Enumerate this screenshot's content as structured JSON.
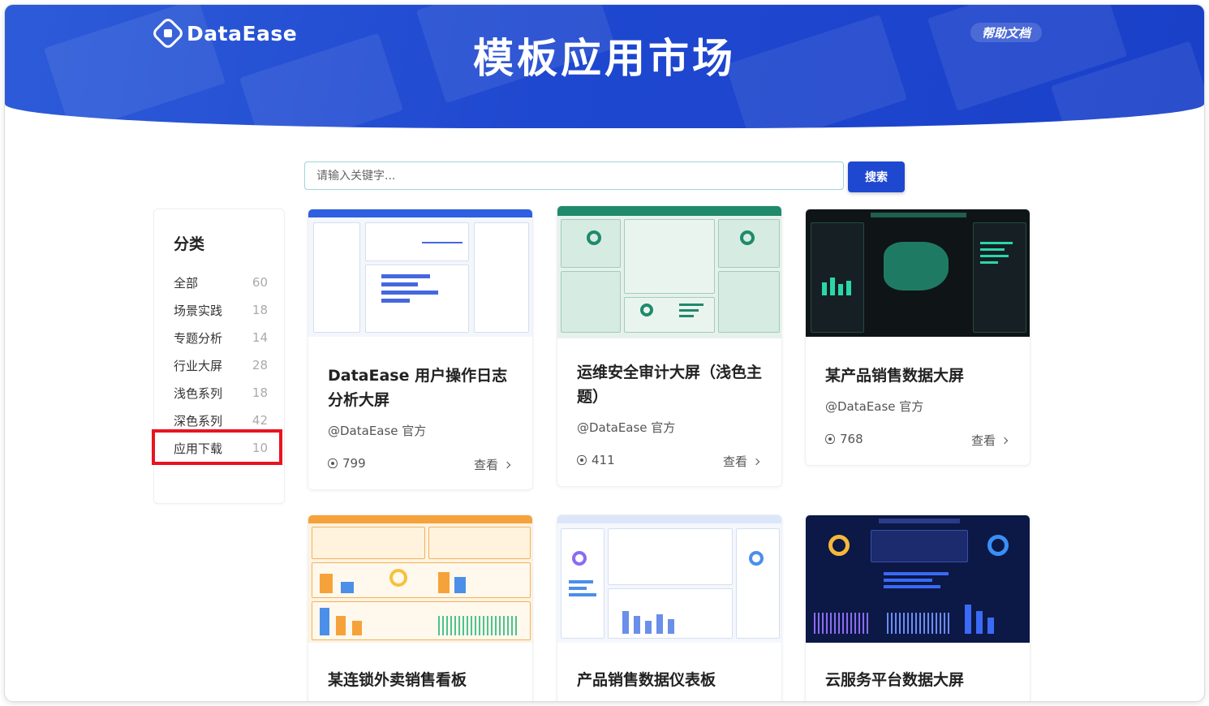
{
  "brand": {
    "logo_text": "DataEase"
  },
  "banner": {
    "title": "模板应用市场",
    "help_label": "帮助文档"
  },
  "search": {
    "placeholder": "请输入关键字...",
    "button_label": "搜索"
  },
  "sidebar": {
    "title": "分类",
    "items": [
      {
        "label": "全部",
        "count": "60"
      },
      {
        "label": "场景实践",
        "count": "18"
      },
      {
        "label": "专题分析",
        "count": "14"
      },
      {
        "label": "行业大屏",
        "count": "28"
      },
      {
        "label": "浅色系列",
        "count": "18"
      },
      {
        "label": "深色系列",
        "count": "42"
      },
      {
        "label": "应用下载",
        "count": "10"
      }
    ]
  },
  "cards": [
    {
      "title": "DataEase 用户操作日志分析大屏",
      "author": "@DataEase 官方",
      "views": "799",
      "view_label": "查看"
    },
    {
      "title": "运维安全审计大屏（浅色主题）",
      "author": "@DataEase 官方",
      "views": "411",
      "view_label": "查看"
    },
    {
      "title": "某产品销售数据大屏",
      "author": "@DataEase 官方",
      "views": "768",
      "view_label": "查看"
    },
    {
      "title": "某连锁外卖销售看板"
    },
    {
      "title": "产品销售数据仪表板"
    },
    {
      "title": "云服务平台数据大屏"
    }
  ],
  "colors": {
    "primary": "#1f48d0",
    "highlight": "#e8141f"
  }
}
